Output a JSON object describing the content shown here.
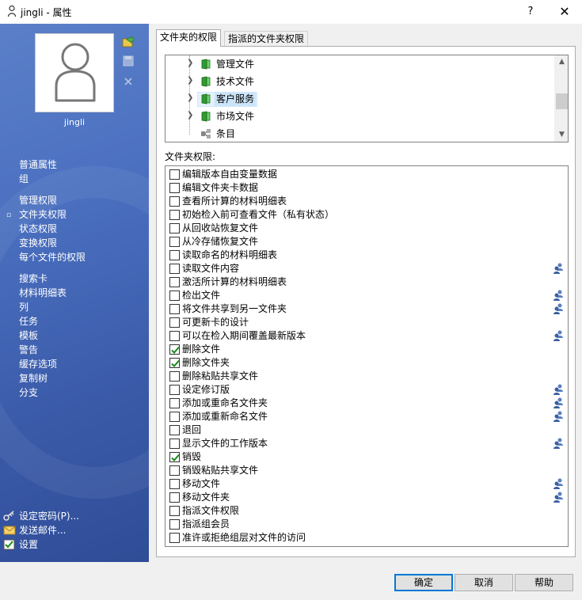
{
  "window": {
    "title": "jingli - 属性",
    "help": "?",
    "close": "✕"
  },
  "user": {
    "name": "jingli"
  },
  "nav": {
    "group1": [
      "普通属性",
      "组"
    ],
    "group2": [
      "管理权限",
      "文件夹权限",
      "状态权限",
      "变换权限",
      "每个文件的权限"
    ],
    "group3": [
      "搜索卡",
      "材料明细表",
      "列",
      "任务",
      "模板",
      "警告",
      "缓存选项",
      "复制树",
      "分支"
    ],
    "selected_bullet": "▫",
    "bottom": [
      "设定密码(P)...",
      "发送邮件...",
      "设置"
    ]
  },
  "tabs": [
    "文件夹的权限",
    "指派的文件夹权限"
  ],
  "tree": {
    "items": [
      {
        "label": "管理文件",
        "icon": "folder-icon"
      },
      {
        "label": "技术文件",
        "icon": "folder-icon"
      },
      {
        "label": "客户服务",
        "icon": "folder-icon",
        "selected": true
      },
      {
        "label": "市场文件",
        "icon": "folder-icon"
      },
      {
        "label": "条目",
        "icon": "items-icon"
      }
    ]
  },
  "permissions_label": "文件夹权限:",
  "permissions": [
    {
      "label": "编辑版本自由变量数据",
      "checked": false,
      "group": false
    },
    {
      "label": "编辑文件夹卡数据",
      "checked": false,
      "group": false
    },
    {
      "label": "查看所计算的材料明细表",
      "checked": false,
      "group": false
    },
    {
      "label": "初始检入前可查看文件（私有状态）",
      "checked": false,
      "group": false
    },
    {
      "label": "从回收站恢复文件",
      "checked": false,
      "group": false
    },
    {
      "label": "从冷存储恢复文件",
      "checked": false,
      "group": false
    },
    {
      "label": "读取命名的材料明细表",
      "checked": false,
      "group": false
    },
    {
      "label": "读取文件内容",
      "checked": false,
      "group": true
    },
    {
      "label": "激活所计算的材料明细表",
      "checked": false,
      "group": false
    },
    {
      "label": "检出文件",
      "checked": false,
      "group": true
    },
    {
      "label": "将文件共享到另一文件夹",
      "checked": false,
      "group": true
    },
    {
      "label": "可更新卡的设计",
      "checked": false,
      "group": false
    },
    {
      "label": "可以在检入期间覆盖最新版本",
      "checked": false,
      "group": true
    },
    {
      "label": "删除文件",
      "checked": true,
      "group": false
    },
    {
      "label": "删除文件夹",
      "checked": true,
      "group": false
    },
    {
      "label": "删除粘贴共享文件",
      "checked": false,
      "group": false
    },
    {
      "label": "设定修订版",
      "checked": false,
      "group": true
    },
    {
      "label": "添加或重命名文件夹",
      "checked": false,
      "group": true
    },
    {
      "label": "添加或重新命名文件",
      "checked": false,
      "group": true
    },
    {
      "label": "退回",
      "checked": false,
      "group": false
    },
    {
      "label": "显示文件的工作版本",
      "checked": false,
      "group": true
    },
    {
      "label": "销毁",
      "checked": true,
      "group": false
    },
    {
      "label": "销毁粘贴共享文件",
      "checked": false,
      "group": false
    },
    {
      "label": "移动文件",
      "checked": false,
      "group": true
    },
    {
      "label": "移动文件夹",
      "checked": false,
      "group": true
    },
    {
      "label": "指派文件权限",
      "checked": false,
      "group": false
    },
    {
      "label": "指派组会员",
      "checked": false,
      "group": false
    },
    {
      "label": "准许或拒绝组层对文件的访问",
      "checked": false,
      "group": false
    }
  ],
  "buttons": {
    "ok": "确定",
    "cancel": "取消",
    "help": "帮助"
  },
  "colors": {
    "panel_blue": "#4a6fbf",
    "check_green": "#1a8a1a",
    "folder_green": "#2e9b2e",
    "default_button": "#0078d7"
  }
}
